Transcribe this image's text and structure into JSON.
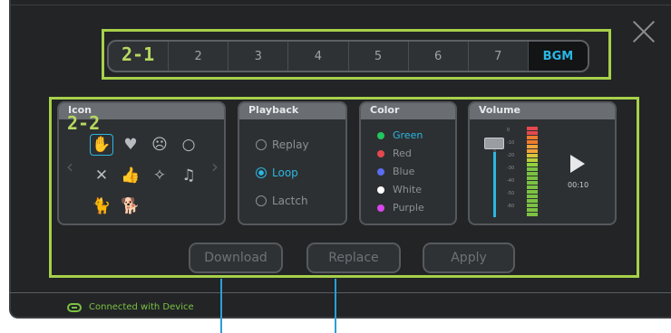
{
  "tabs": {
    "items": [
      "2-1",
      "2",
      "3",
      "4",
      "5",
      "6",
      "7",
      "BGM"
    ],
    "active": "BGM"
  },
  "tags": {
    "tabs_tag": "2-1",
    "panels_tag": "2-2"
  },
  "panels": {
    "icon": {
      "title": "Icon",
      "icons": [
        "hand-icon",
        "heart-icon",
        "sad-face-icon",
        "circle-icon",
        "x-icon",
        "thumbs-up-icon",
        "sparkle-icon",
        "music-icon",
        "cat-icon",
        "dog-icon"
      ]
    },
    "playback": {
      "title": "Playback",
      "options": [
        "Replay",
        "Loop",
        "Lactch"
      ],
      "selected": "Loop"
    },
    "color": {
      "title": "Color",
      "options": [
        {
          "label": "Green",
          "color": "#22c55e"
        },
        {
          "label": "Red",
          "color": "#e5484d"
        },
        {
          "label": "Blue",
          "color": "#5b6cf0"
        },
        {
          "label": "White",
          "color": "#ffffff"
        },
        {
          "label": "Purple",
          "color": "#d946ef"
        }
      ],
      "selected": "Green"
    },
    "volume": {
      "title": "Volume",
      "scale": [
        "0",
        "-10",
        "-20",
        "-30",
        "-40",
        "-50",
        "-60"
      ],
      "time": "00:10",
      "level": 0.82
    }
  },
  "buttons": {
    "download": "Download",
    "replace": "Replace",
    "apply": "Apply"
  },
  "status": {
    "text": "Connected with Device"
  },
  "colors": {
    "accent": "#2ab7e3",
    "highlight": "#a7d04a",
    "status": "#7cc242"
  }
}
